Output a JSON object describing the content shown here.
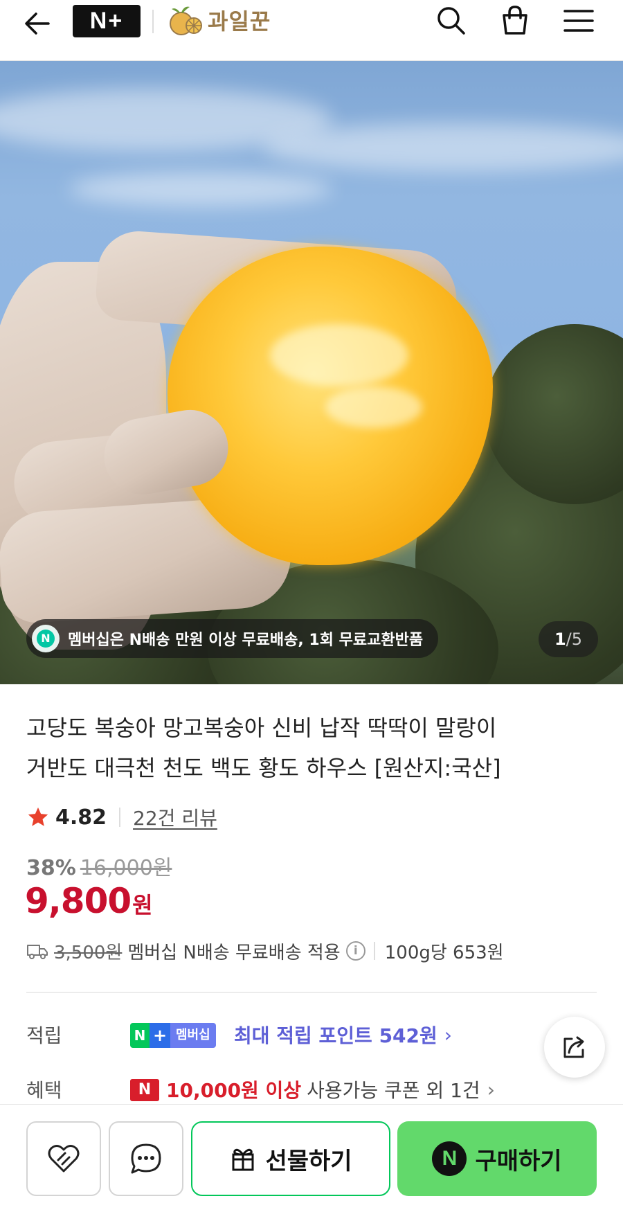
{
  "header": {
    "nplus_logo": "N+",
    "store_name": "과일꾼",
    "icons": [
      "back-arrow-icon",
      "search-icon",
      "shopping-bag-icon",
      "menu-icon"
    ]
  },
  "hero": {
    "membership_banner": "멤버십은 N배송 만원 이상 무료배송, 1회 무료교환반품",
    "badge_icon": "N",
    "pager_current": "1",
    "pager_total": "/5"
  },
  "product": {
    "title_line1": "고당도 복숭아 망고복숭아 신비 납작 딱딱이 말랑이",
    "title_line2": "거반도 대극천 천도 백도 황도 하우스 [원산지:국산]",
    "rating_score": "4.82",
    "review_count": "22건 리뷰",
    "discount_pct": "38%",
    "original_price": "16,000원",
    "price_value": "9,800",
    "price_unit": "원",
    "shipping_fee": "3,500원",
    "shipping_note": "멤버십 N배송 무료배송 적용",
    "info_symbol": "i",
    "unit_price": "100g당 653원"
  },
  "benefits": {
    "points_label": "적립",
    "points_badge_n": "N",
    "points_badge_plus": "+",
    "points_badge_member": "멤버십",
    "points_text": "최대 적립 포인트 542원",
    "benefit_label": "혜택",
    "coupon_badge": "N",
    "coupon_highlight": "10,000원 이상",
    "coupon_rest": "사용가능 쿠폰 외 1건",
    "chevron": "›"
  },
  "bottom_bar": {
    "gift_label": "선물하기",
    "buy_label": "구매하기",
    "buy_badge": "N"
  },
  "colors": {
    "price_red": "#c8102e",
    "naver_green": "#03c75a",
    "buy_button_green": "#62d96b",
    "points_purple": "#5d5fd6"
  }
}
